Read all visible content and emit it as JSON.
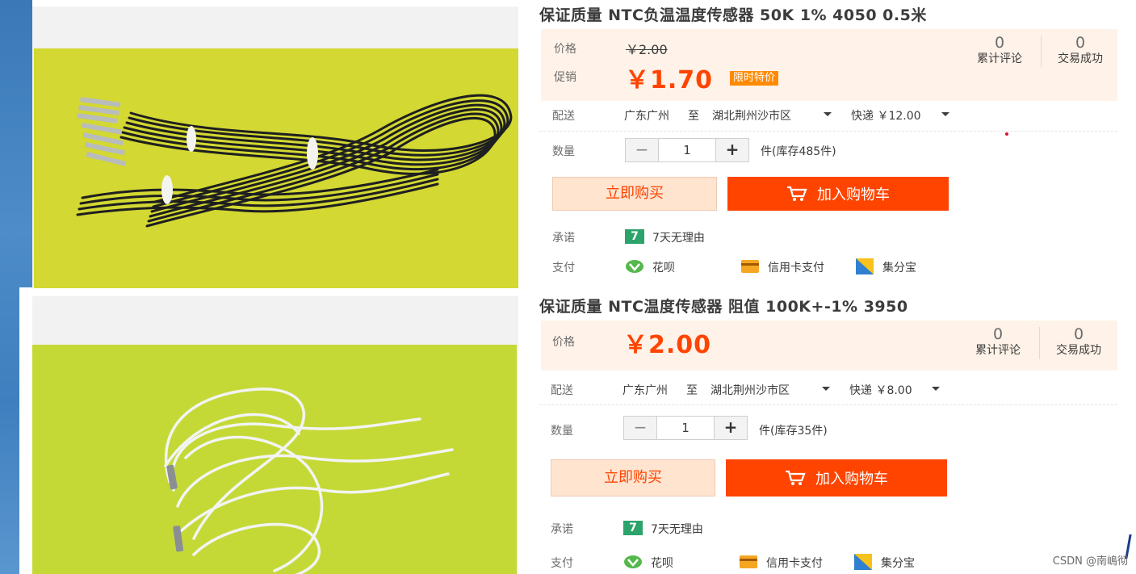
{
  "products": [
    {
      "title": "保证质量 NTC负温温度传感器 50K 1% 4050 0.5米",
      "price_label": "价格",
      "original_price": "￥2.00",
      "promo_label": "促销",
      "promo_price": "￥1.70",
      "promo_tag": "限时特价",
      "reviews_count": "0",
      "reviews_label": "累计评论",
      "deals_count": "0",
      "deals_label": "交易成功",
      "delivery_label": "配送",
      "from": "广东广州",
      "to_word": "至",
      "destination": "湖北荆州沙市区",
      "shipping": "快递 ￥12.00",
      "quantity_label": "数量",
      "quantity_value": "1",
      "stock": "件(库存485件)",
      "buy_now": "立即购买",
      "add_to_cart": "加入购物车",
      "promise_label": "承诺",
      "promise_badge": "7",
      "promise_text": "7天无理由",
      "payment_label": "支付",
      "payments": [
        "花呗",
        "信用卡支付",
        "集分宝"
      ],
      "watermark": "http://mt5852.taobao.com/"
    },
    {
      "title": "保证质量 NTC温度传感器 阻值 100K+-1% 3950",
      "price_label": "价格",
      "promo_price": "￥2.00",
      "reviews_count": "0",
      "reviews_label": "累计评论",
      "deals_count": "0",
      "deals_label": "交易成功",
      "delivery_label": "配送",
      "from": "广东广州",
      "to_word": "至",
      "destination": "湖北荆州沙市区",
      "shipping": "快递 ￥8.00",
      "quantity_label": "数量",
      "quantity_value": "1",
      "stock": "件(库存35件)",
      "buy_now": "立即购买",
      "add_to_cart": "加入购物车",
      "promise_label": "承诺",
      "promise_badge": "7",
      "promise_text": "7天无理由",
      "payment_label": "支付",
      "payments": [
        "花呗",
        "信用卡支付",
        "集分宝"
      ]
    }
  ],
  "qty_minus": "−",
  "qty_plus": "+",
  "csdn_watermark": "CSDN @南嶋彻",
  "colors": {
    "accent": "#ff4400",
    "price_bg": "#fff2e8",
    "photo1_bg": "#d3d832",
    "photo2_bg": "#c5d936"
  }
}
